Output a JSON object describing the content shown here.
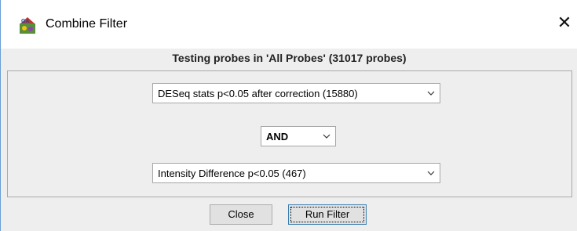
{
  "window": {
    "title": "Combine Filter",
    "icon": "seqmonk-app-icon",
    "close_glyph": "✕"
  },
  "header": {
    "text": "Testing probes in 'All Probes' (31017 probes)"
  },
  "filters": {
    "first": {
      "selected": "DESeq stats p<0.05 after correction (15880)"
    },
    "operator": {
      "selected": "AND"
    },
    "second": {
      "selected": "Intensity Difference p<0.05 (467)"
    }
  },
  "buttons": {
    "close_label": "Close",
    "run_label": "Run Filter"
  },
  "colors": {
    "content_bg": "#eeeeee",
    "window_border": "#6b9ed6",
    "default_button_border": "#3c7fb1"
  }
}
